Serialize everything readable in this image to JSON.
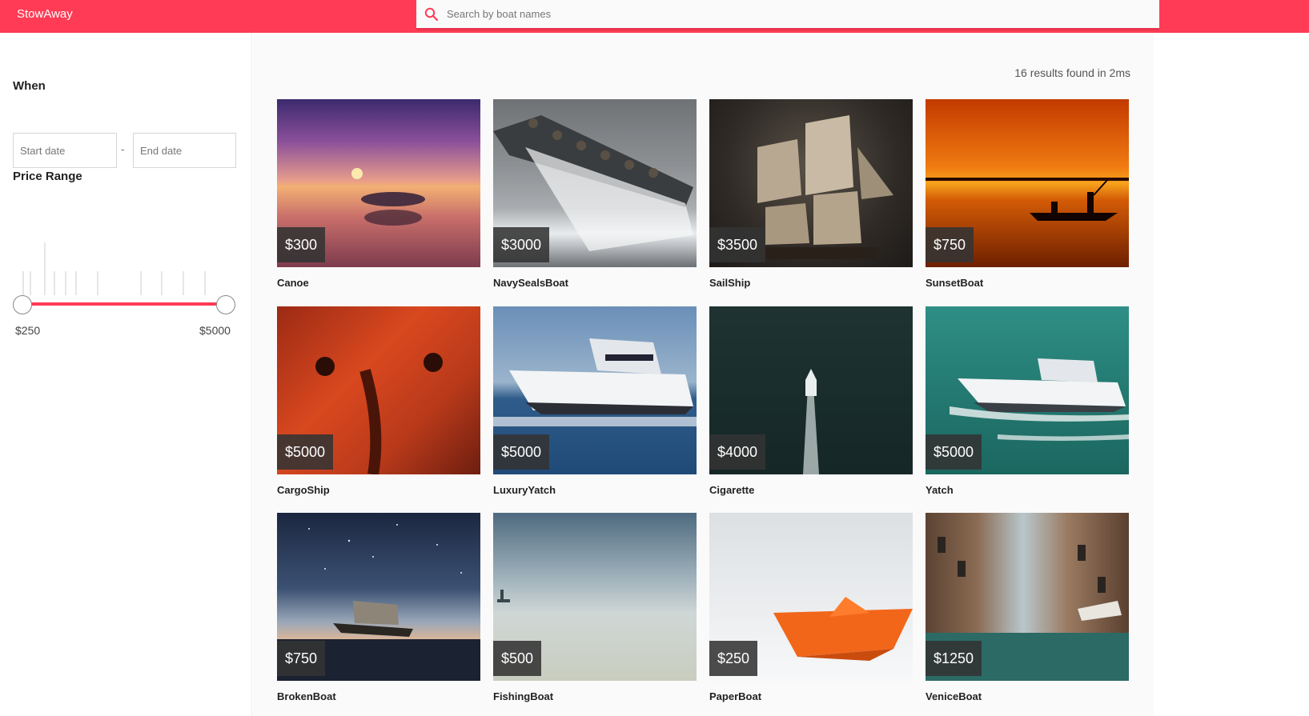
{
  "header": {
    "brand": "StowAway",
    "search_placeholder": "Search by boat names",
    "color": "#ff3b55"
  },
  "sidebar": {
    "when_label": "When",
    "start_placeholder": "Start date",
    "end_placeholder": "End date",
    "dash": "-",
    "price_range_label": "Price Range",
    "min_label": "$250",
    "max_label": "$5000"
  },
  "results": {
    "text": "16 results found in 2ms"
  },
  "boats": [
    {
      "name": "Canoe",
      "price": "$300"
    },
    {
      "name": "NavySealsBoat",
      "price": "$3000"
    },
    {
      "name": "SailShip",
      "price": "$3500"
    },
    {
      "name": "SunsetBoat",
      "price": "$750"
    },
    {
      "name": "CargoShip",
      "price": "$5000"
    },
    {
      "name": "LuxuryYatch",
      "price": "$5000"
    },
    {
      "name": "Cigarette",
      "price": "$4000"
    },
    {
      "name": "Yatch",
      "price": "$5000"
    },
    {
      "name": "BrokenBoat",
      "price": "$750"
    },
    {
      "name": "FishingBoat",
      "price": "$500"
    },
    {
      "name": "PaperBoat",
      "price": "$250"
    },
    {
      "name": "VeniceBoat",
      "price": "$1250"
    }
  ]
}
